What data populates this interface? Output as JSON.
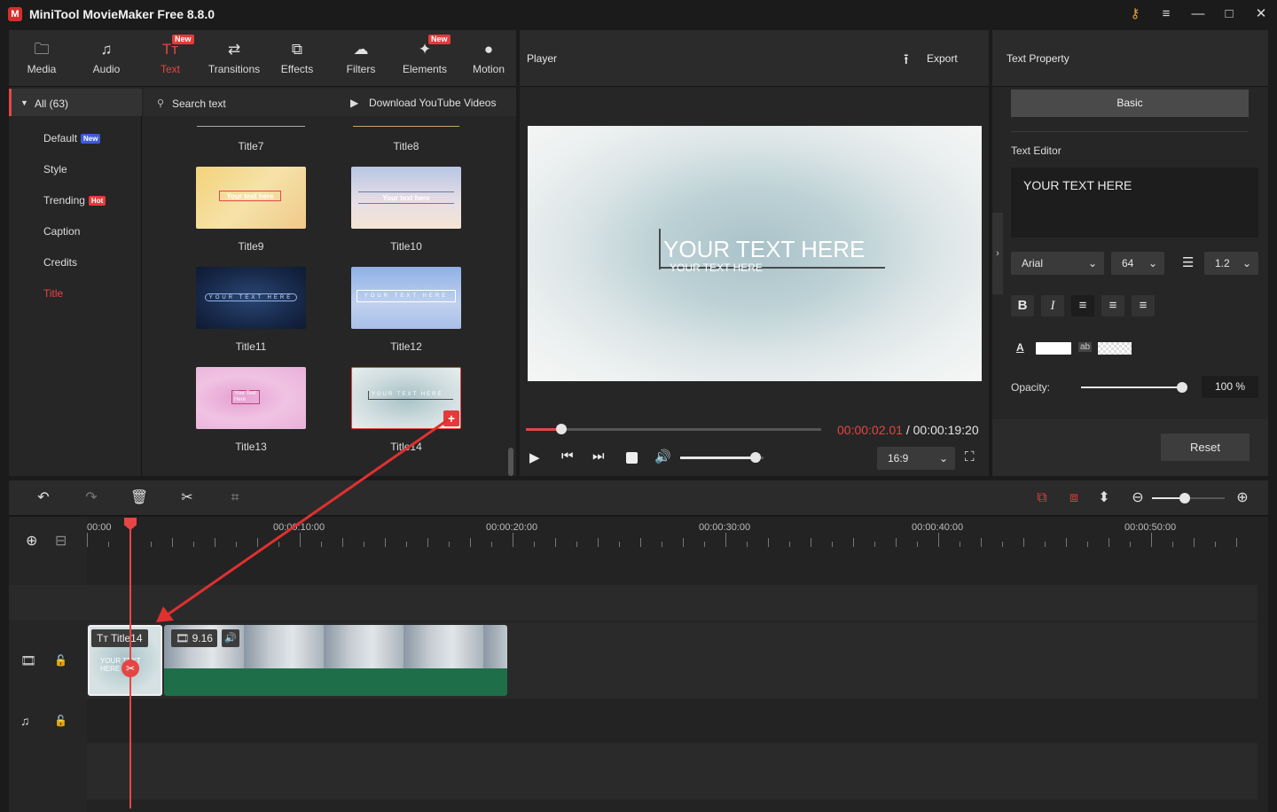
{
  "app": {
    "title": "MiniTool MovieMaker Free 8.8.0"
  },
  "toolbar": {
    "items": [
      {
        "label": "Media",
        "icon": "folder-icon",
        "new": false
      },
      {
        "label": "Audio",
        "icon": "music-icon",
        "new": false
      },
      {
        "label": "Text",
        "icon": "text-icon",
        "new": true
      },
      {
        "label": "Transitions",
        "icon": "transitions-icon",
        "new": false
      },
      {
        "label": "Effects",
        "icon": "effects-icon",
        "new": false
      },
      {
        "label": "Filters",
        "icon": "filters-icon",
        "new": false
      },
      {
        "label": "Elements",
        "icon": "elements-icon",
        "new": true
      },
      {
        "label": "Motion",
        "icon": "motion-icon",
        "new": false
      }
    ],
    "new_badge": "New"
  },
  "categories": {
    "all": "All (63)",
    "items": [
      {
        "label": "Default",
        "badge": "New"
      },
      {
        "label": "Style",
        "badge": ""
      },
      {
        "label": "Trending",
        "badge": "Hot"
      },
      {
        "label": "Caption",
        "badge": ""
      },
      {
        "label": "Credits",
        "badge": ""
      },
      {
        "label": "Title",
        "badge": ""
      }
    ]
  },
  "library": {
    "search_placeholder": "Search text",
    "download_label": "Download YouTube Videos",
    "top_row": [
      "Title7",
      "Title8"
    ],
    "thumbs": [
      {
        "name": "Title9",
        "text": "Your text here"
      },
      {
        "name": "Title10",
        "text": "Your text here"
      },
      {
        "name": "Title11",
        "text": "YOUR TEXT HERE"
      },
      {
        "name": "Title12",
        "text": "YOUR TEXT HERE"
      },
      {
        "name": "Title13",
        "text": "Your Text Here"
      },
      {
        "name": "Title14",
        "text": "YOUR TEXT HERE"
      }
    ]
  },
  "player": {
    "label": "Player",
    "export_label": "Export",
    "preview_title": "YOUR TEXT HERE",
    "preview_subtitle": "YOUR TEXT HERE",
    "current_time": "00:00:02.01",
    "separator": " / ",
    "total_time": "00:00:19:20",
    "aspect": "16:9",
    "progress": 0.12,
    "volume": 0.9
  },
  "text_property": {
    "header": "Text Property",
    "tab": "Basic",
    "editor_label": "Text Editor",
    "editor_value": "YOUR TEXT HERE",
    "font": "Arial",
    "size": "64",
    "line_spacing": "1.2",
    "text_color": "#ffffff",
    "opacity_label": "Opacity:",
    "opacity_value": "100 %",
    "opacity": 1.0,
    "reset_label": "Reset"
  },
  "timeline": {
    "ruler": [
      "00:00",
      "00:00:10:00",
      "00:00:20:00",
      "00:00:30:00",
      "00:00:40:00",
      "00:00:50:00"
    ],
    "text_clip_label": "Title14",
    "video_clip_duration": "9.16",
    "zoom": 0.45
  },
  "colors": {
    "accent": "#e64545",
    "background": "#1b1b1b",
    "panel": "#262626"
  }
}
